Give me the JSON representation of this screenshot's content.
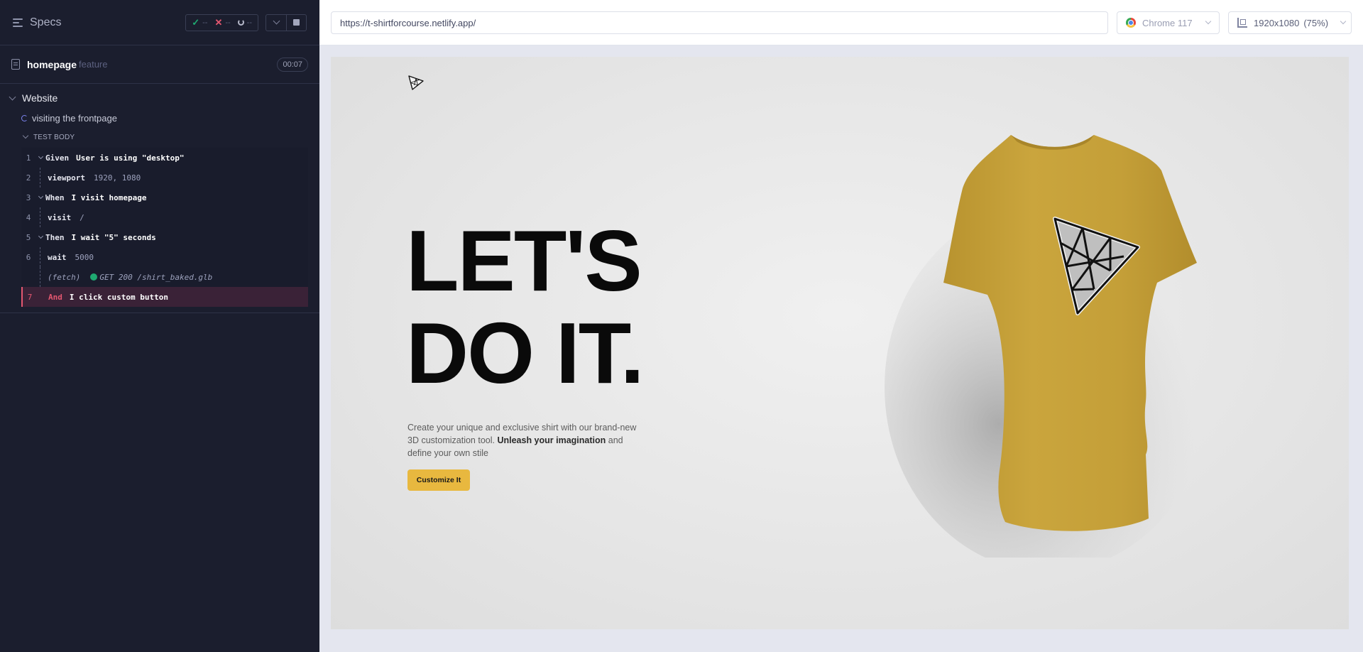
{
  "runner": {
    "title": "Specs",
    "stats": {
      "passed": "--",
      "failed": "--",
      "pending": "--"
    },
    "spec": {
      "name": "homepage",
      "ext": "feature",
      "duration": "00:07"
    },
    "suite": "Website",
    "test": "visiting the frontpage",
    "body_label": "TEST BODY",
    "commands": [
      {
        "num": "1",
        "kw": "Given",
        "text": "User is using \"desktop\""
      },
      {
        "num": "2",
        "name": "viewport",
        "arg": "1920, 1080"
      },
      {
        "num": "3",
        "kw": "When",
        "text": "I visit homepage"
      },
      {
        "num": "4",
        "name": "visit",
        "arg": "/"
      },
      {
        "num": "5",
        "kw": "Then",
        "text": "I wait \"5\" seconds"
      },
      {
        "num": "6",
        "name": "wait",
        "arg": "5000"
      },
      {
        "fetch": "(fetch)",
        "text": "GET 200 /shirt_baked.glb"
      },
      {
        "num": "7",
        "kw": "And",
        "text": "I click custom button"
      }
    ]
  },
  "browser": {
    "url": "https://t-shirtforcourse.netlify.app/",
    "name": "Chrome 117",
    "viewport": "1920x1080",
    "zoom": "(75%)"
  },
  "site": {
    "headline_line1": "LET'S",
    "headline_line2": "DO IT.",
    "desc_before": "Create your unique and exclusive shirt with our brand-new 3D customization tool. ",
    "desc_bold": "Unleash your imagination",
    "desc_after": " and define your own stile",
    "cta": "Customize It",
    "shirt_color": "#c9a43a"
  }
}
